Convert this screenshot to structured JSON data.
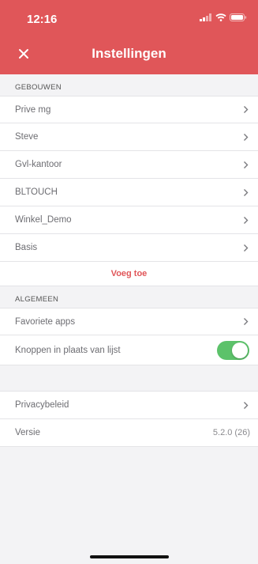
{
  "status_bar": {
    "time": "12:16"
  },
  "header": {
    "title": "Instellingen"
  },
  "sections": {
    "buildings": {
      "title": "GEBOUWEN",
      "items": [
        "Prive mg",
        "Steve",
        "Gvl-kantoor",
        "BLTOUCH",
        "Winkel_Demo",
        "Basis"
      ],
      "add_label": "Voeg toe"
    },
    "general": {
      "title": "ALGEMEEN",
      "favorite_apps": "Favoriete apps",
      "buttons_instead_of_list": "Knoppen in plaats van lijst",
      "toggle_on": true
    },
    "other": {
      "privacy": "Privacybeleid",
      "version_label": "Versie",
      "version_value": "5.2.0 (26)"
    }
  },
  "colors": {
    "accent": "#e05659",
    "toggle": "#5cc26a"
  }
}
